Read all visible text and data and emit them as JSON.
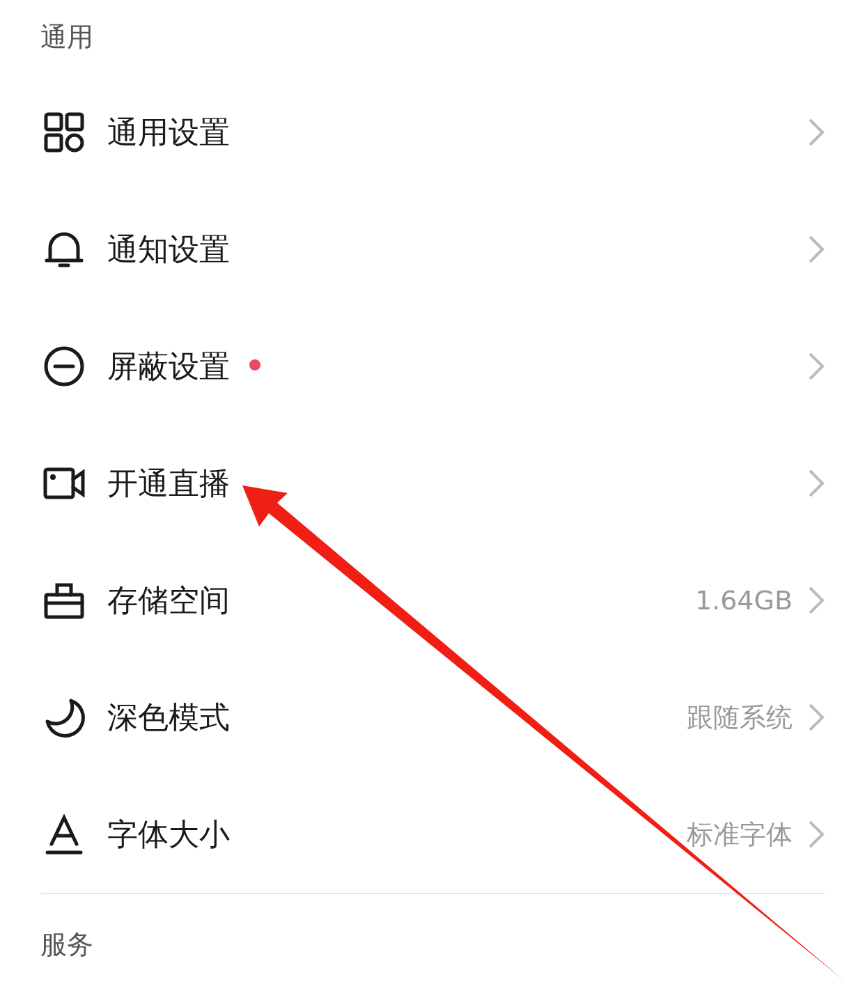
{
  "sections": [
    {
      "title": "通用",
      "items": [
        {
          "label": "通用设置"
        },
        {
          "label": "通知设置"
        },
        {
          "label": "屏蔽设置",
          "new_dot": true
        },
        {
          "label": "开通直播"
        },
        {
          "label": "存储空间",
          "value": "1.64GB"
        },
        {
          "label": "深色模式",
          "value": "跟随系统"
        },
        {
          "label": "字体大小",
          "value": "标准字体"
        }
      ]
    },
    {
      "title": "服务"
    }
  ],
  "annotation": {
    "kind": "arrow"
  }
}
